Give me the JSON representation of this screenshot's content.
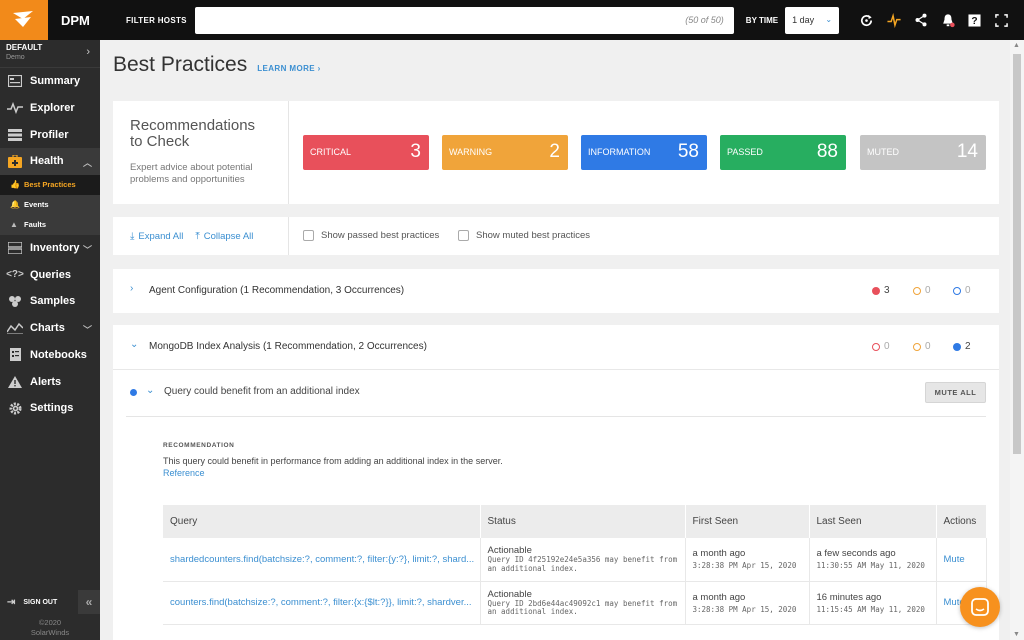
{
  "app": {
    "name": "DPM"
  },
  "topbar": {
    "filter_label": "FILTER HOSTS",
    "filter_count": "(50 of 50)",
    "bytime_label": "BY TIME",
    "time_value": "1 day"
  },
  "sidebar": {
    "org_name": "DEFAULT",
    "org_sub": "Demo",
    "items": [
      {
        "label": "Summary",
        "icon": "summary-icon"
      },
      {
        "label": "Explorer",
        "icon": "pulse-icon"
      },
      {
        "label": "Profiler",
        "icon": "list-icon"
      },
      {
        "label": "Health",
        "icon": "health-icon"
      },
      {
        "label": "Inventory",
        "icon": "inventory-icon"
      },
      {
        "label": "Queries",
        "icon": "code-icon"
      },
      {
        "label": "Samples",
        "icon": "samples-icon"
      },
      {
        "label": "Charts",
        "icon": "charts-icon"
      },
      {
        "label": "Notebooks",
        "icon": "notebook-icon"
      },
      {
        "label": "Alerts",
        "icon": "alert-icon"
      },
      {
        "label": "Settings",
        "icon": "gear-icon"
      }
    ],
    "health_sub": [
      {
        "label": "Best Practices"
      },
      {
        "label": "Events"
      },
      {
        "label": "Faults"
      }
    ],
    "sign_out": "SIGN OUT",
    "copyright_year": "©2020",
    "copyright_name": "SolarWinds"
  },
  "page": {
    "title": "Best Practices",
    "learn_more": "LEARN MORE ›"
  },
  "recommendations": {
    "title_line1": "Recommendations",
    "title_line2": "to Check",
    "desc_line1": "Expert advice about potential",
    "desc_line2": "problems and opportunities",
    "stats": [
      {
        "label": "CRITICAL",
        "value": "3",
        "color": "#e8505b"
      },
      {
        "label": "WARNING",
        "value": "2",
        "color": "#f0a43a"
      },
      {
        "label": "INFORMATION",
        "value": "58",
        "color": "#2f7ae5"
      },
      {
        "label": "PASSED",
        "value": "88",
        "color": "#27ae60"
      },
      {
        "label": "MUTED",
        "value": "14",
        "color": "#c4c4c4"
      }
    ]
  },
  "toolbar": {
    "expand_all": "Expand All",
    "collapse_all": "Collapse All",
    "show_passed": "Show passed best practices",
    "show_muted": "Show muted best practices"
  },
  "groups": [
    {
      "title": "Agent Configuration (1 Recommendation, 3 Occurrences)",
      "critical": "3",
      "warning": "0",
      "info": "0"
    },
    {
      "title": "MongoDB Index Analysis (1 Recommendation, 2 Occurrences)",
      "critical": "0",
      "warning": "0",
      "info": "2"
    }
  ],
  "detail": {
    "title": "Query could benefit from an additional index",
    "mute_all": "MUTE ALL",
    "rec_label": "RECOMMENDATION",
    "rec_text": "This query could benefit in performance from adding an additional index in the server.",
    "reference": "Reference",
    "columns": [
      "Query",
      "Status",
      "First Seen",
      "Last Seen",
      "Actions"
    ],
    "rows": [
      {
        "query": "shardedcounters.find(batchsize:?, comment:?, filter:{y:?}, limit:?, shard...",
        "status": "Actionable",
        "status_sub": "Query ID 4f25192e24e5a356 may benefit from an additional index.",
        "first": "a month ago",
        "first_sub": "3:28:38 PM Apr 15, 2020",
        "last": "a few seconds ago",
        "last_sub": "11:30:55 AM May 11, 2020",
        "action": "Mute"
      },
      {
        "query": "counters.find(batchsize:?, comment:?, filter:{x:{$lt:?}}, limit:?, shardver...",
        "status": "Actionable",
        "status_sub": "Query ID 2bd6e44ac49092c1 may benefit from an additional index.",
        "first": "a month ago",
        "first_sub": "3:28:38 PM Apr 15, 2020",
        "last": "16 minutes ago",
        "last_sub": "11:15:45 AM May 11, 2020",
        "action": "Mute"
      }
    ]
  }
}
